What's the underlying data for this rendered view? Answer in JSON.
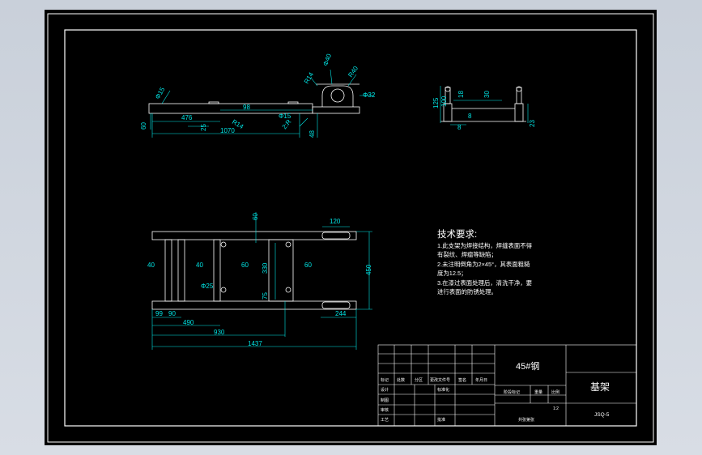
{
  "drawing": {
    "title": "技术要求:",
    "notes": [
      "1.此支架为焊接结构，焊缝表面不得",
      "有裂纹、焊瘤等缺陷；",
      "2.未注明倒角为2×45°，其表面粗糙",
      "度为12.5；",
      "3.在漆过表面处理后，清洗干净，要",
      "进行表面的防锈处理。"
    ]
  },
  "views": {
    "front": [
      "Φ15",
      "Φ40",
      "R40",
      "R14",
      "Φ32",
      "98",
      "476",
      "R14",
      "Φ15",
      "2:R",
      "25",
      "60",
      "48",
      "1070"
    ],
    "side": [
      "125",
      "100",
      "18",
      "30",
      "8",
      "8",
      "23"
    ],
    "top": [
      "60",
      "120",
      "40",
      "40",
      "60",
      "60",
      "330",
      "450",
      "Φ25",
      "75",
      "99",
      "90",
      "490",
      "244",
      "930",
      "1437"
    ]
  },
  "title_block": {
    "material": "45#钢",
    "part_name": "基架",
    "drawing_no": "JSQ-5",
    "scale": "1:2",
    "stage_mark": "阶段标记",
    "weight": "重量",
    "ratio": "比例",
    "sheets": "共张第张",
    "labels": [
      "标记",
      "处数",
      "分区",
      "更改文件号",
      "签名",
      "年月日",
      "设计",
      "标准化",
      "制图",
      "审核",
      "工艺",
      "批准"
    ]
  },
  "colors": {
    "lines": "#ffffff",
    "dims": "#00e5e5",
    "background": "#000000"
  }
}
